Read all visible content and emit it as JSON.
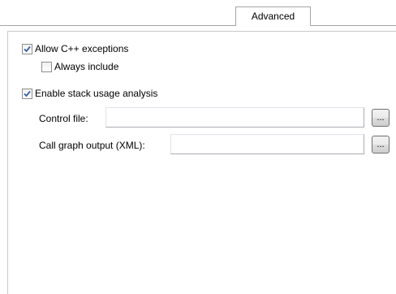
{
  "tabs": {
    "active_label": "Advanced"
  },
  "options": {
    "allow_cpp_exceptions": {
      "label": "Allow C++ exceptions",
      "checked": true
    },
    "always_include": {
      "label": "Always include",
      "checked": false
    },
    "enable_stack_usage": {
      "label": "Enable stack usage analysis",
      "checked": true
    }
  },
  "fields": {
    "control_file": {
      "label": "Control file:",
      "value": "",
      "browse_label": "..."
    },
    "call_graph_output": {
      "label": "Call graph output (XML):",
      "value": "",
      "browse_label": "..."
    }
  },
  "colors": {
    "checkmark": "#3a5fa8",
    "border": "#a6a6a6"
  },
  "icons": {
    "checkmark": "checkmark-icon"
  }
}
